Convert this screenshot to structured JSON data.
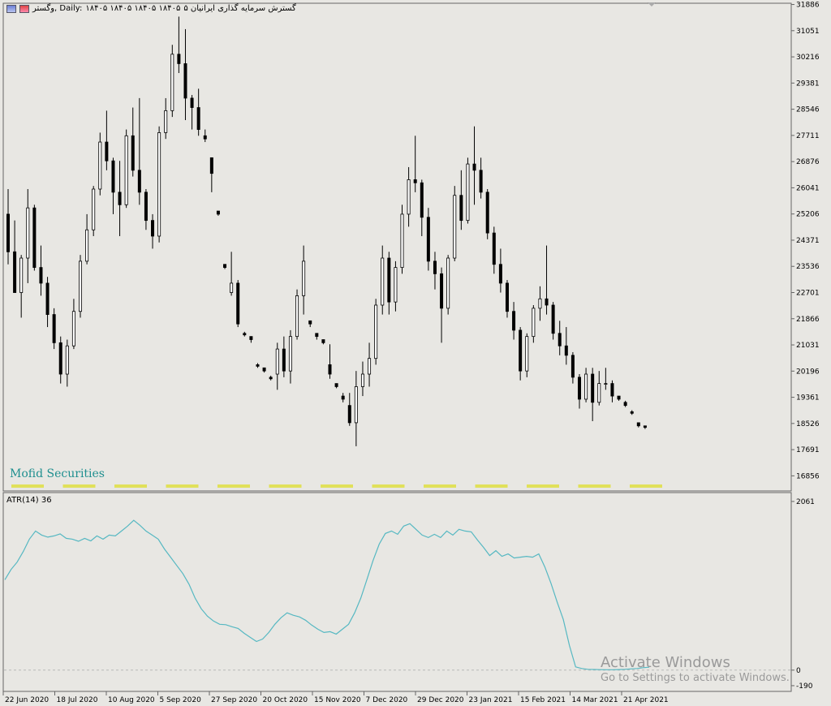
{
  "header": {
    "title": "گسترش سرمایه گذاری ایرانیان ۵",
    "ohlc": "۱۸۴۰۵ ۱۸۴۰۵ ۱۸۴۰۵ ۱۸۴۰۵",
    "symbol": "وگستر, Daily:"
  },
  "watermark": "Mofid Securities",
  "atr_label": "ATR(14) 36",
  "os_notice": {
    "line1": "Activate Windows",
    "line2": "Go to Settings to activate Windows."
  },
  "colors": {
    "background": "#e8e7e3",
    "candle": "#000000",
    "atr_line": "#56b8c2",
    "ticker_markers": "#e0e05a"
  },
  "icons": [
    "chart-window-icon",
    "terminal-icon",
    "scroll-shift-icon"
  ],
  "chart_data": [
    {
      "type": "candlestick",
      "title": "گسترش سرمایه گذاری ایرانیان ۵",
      "y_ticks": [
        31886,
        31051,
        30216,
        29381,
        28546,
        27711,
        26876,
        26041,
        25206,
        24371,
        23536,
        22701,
        21866,
        21031,
        20196,
        19361,
        18526,
        17691,
        16856
      ],
      "ylim": [
        16400,
        31900
      ],
      "x_tick_labels": [
        "22 Jun 2020",
        "18 Jul 2020",
        "10 Aug 2020",
        "5 Sep 2020",
        "27 Sep 2020",
        "20 Oct 2020",
        "15 Nov 2020",
        "7 Dec 2020",
        "29 Dec 2020",
        "23 Jan 2021",
        "15 Feb 2021",
        "14 Mar 2021",
        "21 Apr 2021"
      ],
      "ohlc": [
        [
          25200,
          26000,
          23600,
          24000
        ],
        [
          24000,
          25000,
          22700,
          22700
        ],
        [
          22700,
          23900,
          21900,
          23800
        ],
        [
          23800,
          26000,
          23000,
          25400
        ],
        [
          25400,
          25500,
          23400,
          23500
        ],
        [
          23500,
          24200,
          22600,
          23000
        ],
        [
          23000,
          23200,
          21600,
          22000
        ],
        [
          22000,
          22200,
          20900,
          21100
        ],
        [
          21100,
          21300,
          19800,
          20100
        ],
        [
          20100,
          21200,
          19700,
          21000
        ],
        [
          21000,
          22500,
          20900,
          22100
        ],
        [
          22100,
          23900,
          21900,
          23700
        ],
        [
          23700,
          25200,
          23600,
          24700
        ],
        [
          24700,
          26100,
          24500,
          26000
        ],
        [
          26000,
          27800,
          25800,
          27500
        ],
        [
          27500,
          28500,
          26600,
          26900
        ],
        [
          26900,
          27000,
          25200,
          25900
        ],
        [
          25900,
          26900,
          24500,
          25500
        ],
        [
          25500,
          27900,
          25400,
          27700
        ],
        [
          27700,
          28600,
          26400,
          26600
        ],
        [
          26600,
          28900,
          25500,
          25900
        ],
        [
          25900,
          26000,
          24700,
          25000
        ],
        [
          25000,
          25200,
          24100,
          24500
        ],
        [
          24500,
          28000,
          24300,
          27800
        ],
        [
          27800,
          28900,
          27600,
          28500
        ],
        [
          28500,
          30600,
          28300,
          30300
        ],
        [
          30300,
          31500,
          29700,
          30000
        ],
        [
          30000,
          31100,
          28200,
          28900
        ],
        [
          28900,
          29000,
          27900,
          28600
        ],
        [
          28600,
          29200,
          27700,
          27900
        ],
        [
          27700,
          27900,
          27500,
          27600
        ],
        [
          27000,
          26900,
          25900,
          26500
        ],
        [
          25300,
          25250,
          25150,
          25200
        ],
        [
          23600,
          23550,
          23450,
          23500
        ],
        [
          22700,
          24000,
          22600,
          23000
        ],
        [
          23000,
          23100,
          21600,
          21700
        ],
        [
          21400,
          21450,
          21300,
          21350
        ],
        [
          21300,
          21250,
          21100,
          21200
        ],
        [
          20400,
          20450,
          20300,
          20350
        ],
        [
          20300,
          20250,
          20150,
          20200
        ],
        [
          20000,
          20050,
          19900,
          19950
        ],
        [
          20100,
          21100,
          19600,
          20900
        ],
        [
          20900,
          21300,
          20000,
          20200
        ],
        [
          20200,
          21500,
          19800,
          21300
        ],
        [
          21300,
          22800,
          21200,
          22600
        ],
        [
          22600,
          24200,
          22000,
          23700
        ],
        [
          21800,
          21750,
          21600,
          21700
        ],
        [
          21400,
          21350,
          21200,
          21300
        ],
        [
          21200,
          21150,
          21050,
          21100
        ],
        [
          20400,
          21050,
          19950,
          20100
        ],
        [
          19800,
          19750,
          19650,
          19700
        ],
        [
          19400,
          19500,
          19200,
          19300
        ],
        [
          19100,
          19500,
          18450,
          18550
        ],
        [
          18550,
          20200,
          17800,
          19700
        ],
        [
          19700,
          20500,
          19400,
          20100
        ],
        [
          20100,
          21100,
          19700,
          20600
        ],
        [
          20600,
          22500,
          20400,
          22300
        ],
        [
          22300,
          24200,
          22000,
          23800
        ],
        [
          23800,
          24000,
          22000,
          22400
        ],
        [
          22400,
          23700,
          22100,
          23500
        ],
        [
          23500,
          25500,
          23300,
          25200
        ],
        [
          25200,
          26700,
          24800,
          26300
        ],
        [
          26300,
          27700,
          25900,
          26200
        ],
        [
          26200,
          26300,
          24500,
          25100
        ],
        [
          25100,
          25400,
          23400,
          23700
        ],
        [
          23700,
          24000,
          22800,
          23300
        ],
        [
          23300,
          23500,
          21100,
          22200
        ],
        [
          22200,
          23900,
          22000,
          23800
        ],
        [
          23800,
          26100,
          23700,
          25800
        ],
        [
          25800,
          26600,
          24700,
          25000
        ],
        [
          25000,
          27000,
          24900,
          26800
        ],
        [
          26800,
          28000,
          25500,
          26600
        ],
        [
          26600,
          27000,
          25700,
          25900
        ],
        [
          25900,
          26000,
          24400,
          24600
        ],
        [
          24600,
          24800,
          23300,
          23600
        ],
        [
          23600,
          24100,
          22700,
          23000
        ],
        [
          23000,
          23100,
          21900,
          22100
        ],
        [
          22100,
          22400,
          21200,
          21500
        ],
        [
          21500,
          21600,
          19900,
          20200
        ],
        [
          20200,
          21400,
          20000,
          21300
        ],
        [
          21300,
          22300,
          21100,
          22200
        ],
        [
          22200,
          22900,
          21800,
          22500
        ],
        [
          22500,
          24200,
          22000,
          22300
        ],
        [
          22300,
          22400,
          21200,
          21400
        ],
        [
          21400,
          21800,
          20700,
          21000
        ],
        [
          21000,
          21600,
          20400,
          20700
        ],
        [
          20700,
          20800,
          19800,
          20000
        ],
        [
          20000,
          20100,
          19000,
          19300
        ],
        [
          19300,
          20300,
          19200,
          20100
        ],
        [
          20100,
          20300,
          18600,
          19200
        ],
        [
          19200,
          20200,
          19100,
          19800
        ],
        [
          19800,
          20300,
          19600,
          19800
        ],
        [
          19800,
          19900,
          19200,
          19400
        ],
        [
          19400,
          19350,
          19250,
          19300
        ],
        [
          19200,
          19250,
          19050,
          19100
        ],
        [
          18900,
          18950,
          18800,
          18850
        ],
        [
          18550,
          18500,
          18400,
          18450
        ],
        [
          18450,
          18400,
          18350,
          18400
        ]
      ]
    },
    {
      "type": "line",
      "title": "ATR(14) 36",
      "y_ticks": [
        2061,
        0,
        -190
      ],
      "ylim": [
        -250,
        2120
      ],
      "series": [
        {
          "name": "ATR(14)",
          "values": [
            1105,
            1230,
            1320,
            1450,
            1600,
            1700,
            1650,
            1625,
            1640,
            1665,
            1610,
            1600,
            1575,
            1610,
            1580,
            1640,
            1600,
            1650,
            1640,
            1700,
            1760,
            1830,
            1770,
            1700,
            1650,
            1600,
            1480,
            1380,
            1280,
            1180,
            1050,
            880,
            750,
            660,
            600,
            560,
            555,
            530,
            510,
            450,
            400,
            350,
            380,
            460,
            560,
            640,
            700,
            670,
            650,
            610,
            550,
            500,
            460,
            470,
            440,
            500,
            560,
            700,
            880,
            1110,
            1340,
            1540,
            1670,
            1700,
            1660,
            1760,
            1790,
            1720,
            1650,
            1620,
            1660,
            1620,
            1700,
            1650,
            1720,
            1700,
            1690,
            1590,
            1500,
            1400,
            1460,
            1390,
            1420,
            1370,
            1380,
            1390,
            1380,
            1420,
            1260,
            1060,
            830,
            620,
            300,
            40,
            20,
            10,
            8,
            6,
            5,
            5,
            7,
            10,
            15,
            20,
            30,
            36
          ]
        }
      ]
    }
  ]
}
